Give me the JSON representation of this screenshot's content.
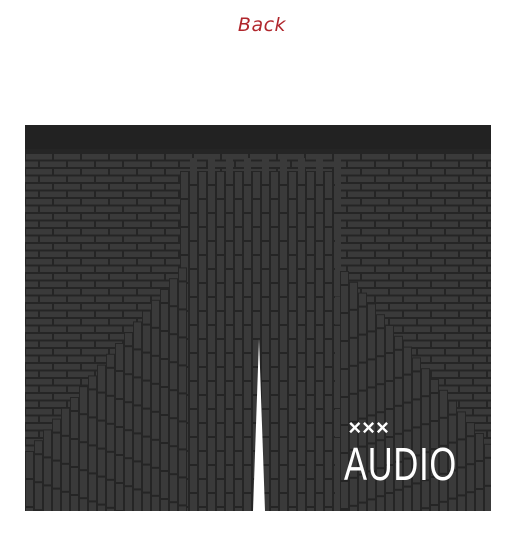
{
  "nav": {
    "back_label": "Back"
  },
  "image": {
    "logo_marks": "×××",
    "logo_text": "AUDIO"
  },
  "colors": {
    "link": "#b0262c",
    "photo_background": "#2b2b2b",
    "brick": "#3a3a3a",
    "mortar": "#252525",
    "top_band": "#222222",
    "logo": "#ffffff"
  },
  "icons": {
    "logo": "crosses-logo-icon"
  }
}
